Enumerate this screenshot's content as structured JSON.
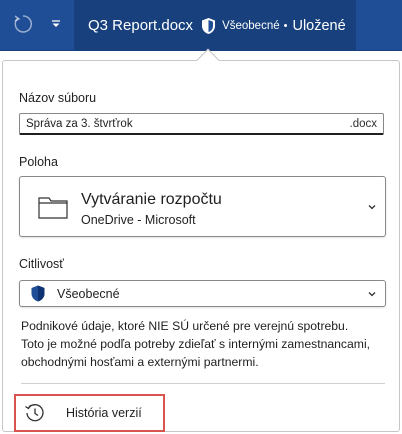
{
  "titlebar": {
    "doc_title": "Q3 Report.docx",
    "sensitivity": "Všeobecné",
    "separator": "•",
    "save_state": "Uložené",
    "undo_icon": "undo-icon",
    "dropdown_icon": "chevron-down-icon",
    "colors": {
      "bar": "#1f4e96",
      "title_area": "#17407d"
    }
  },
  "file_name": {
    "label": "Názov súboru",
    "value": "Správa za 3. štvrťrok",
    "extension": ".docx"
  },
  "location": {
    "label": "Poloha",
    "folder": "Vytváranie rozpočtu",
    "service": "OneDrive - Microsoft",
    "icon": "folder-icon"
  },
  "sensitivity": {
    "label": "Citlivosť",
    "value": "Všeobecné",
    "icon": "shield-icon",
    "shield_color": "#1f4e96",
    "description": "Podnikové údaje, ktoré NIE SÚ určené pre verejnú spotrebu.\nToto je možné podľa potreby zdieľať s internými zamestnancami,\nobchodnými hosťami a externými partnermi."
  },
  "version_history": {
    "label": "História verzií",
    "icon": "history-icon",
    "highlight_color": "#d9534f"
  }
}
